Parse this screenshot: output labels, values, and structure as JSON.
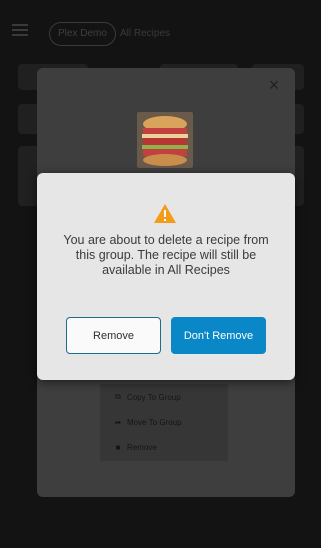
{
  "header": {
    "menu_icon": "hamburger-icon",
    "workspace_pill": "Plex Demo",
    "breadcrumb": "All Recipes"
  },
  "recipe_modal": {
    "close_icon": "close-icon",
    "close_glyph": "×",
    "image_alt": "Sandwich recipe thumbnail",
    "context_menu": {
      "items": [
        {
          "label": "Copy To Group",
          "icon": "copy-icon"
        },
        {
          "label": "Move To Group",
          "icon": "move-icon"
        },
        {
          "label": "Remove",
          "icon": "trash-icon"
        }
      ]
    }
  },
  "confirm_dialog": {
    "icon": "warning-icon",
    "warning_color": "#f29c1a",
    "message": "You are about to delete a recipe from this group. The recipe will still be available in All Recipes",
    "remove_label": "Remove",
    "keep_label": "Don't Remove",
    "primary_color": "#0a87c6"
  }
}
